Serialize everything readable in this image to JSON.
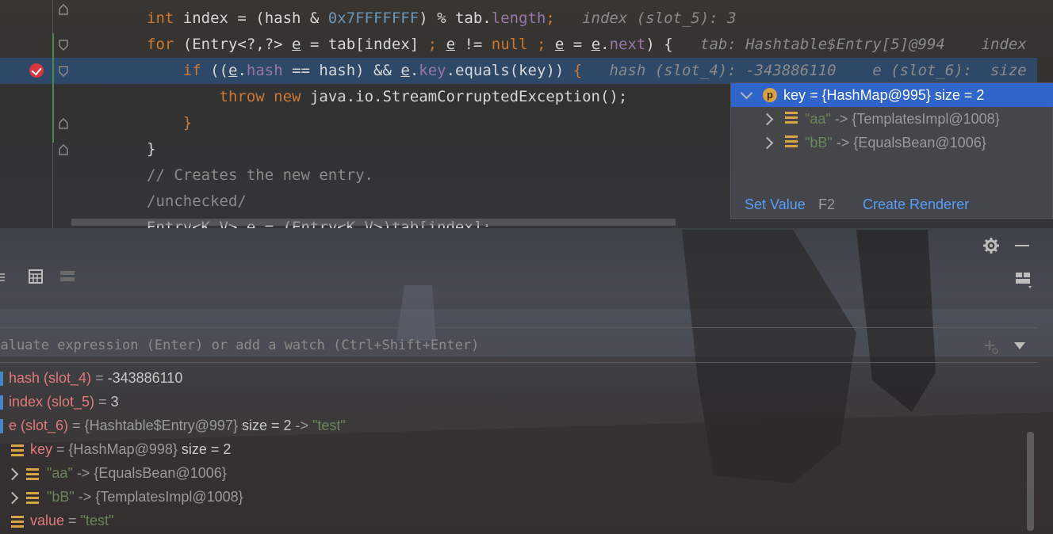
{
  "editor": {
    "lines": [
      {
        "parts": [
          {
            "t": "int",
            "c": "kw"
          },
          {
            "t": " index = (hash & "
          },
          {
            "t": "0x7FFFFFFF",
            "c": "num"
          },
          {
            "t": ") % tab."
          },
          {
            "t": "length",
            "c": "fld"
          },
          {
            "t": ";",
            "c": "kw"
          },
          {
            "t": "   index (slot_5): 3",
            "c": "inl"
          }
        ]
      },
      {
        "parts": [
          {
            "t": "for",
            "c": "kw"
          },
          {
            "t": " (Entry<?,?> "
          },
          {
            "t": "e",
            "c": "uline"
          },
          {
            "t": " = tab[index] "
          },
          {
            "t": ";",
            "c": "kw"
          },
          {
            "t": " "
          },
          {
            "t": "e",
            "c": "uline"
          },
          {
            "t": " != "
          },
          {
            "t": "null",
            "c": "kw"
          },
          {
            "t": " "
          },
          {
            "t": ";",
            "c": "kw"
          },
          {
            "t": " "
          },
          {
            "t": "e",
            "c": "uline"
          },
          {
            "t": " = "
          },
          {
            "t": "e",
            "c": "uline"
          },
          {
            "t": "."
          },
          {
            "t": "next",
            "c": "fld"
          },
          {
            "t": ") {"
          },
          {
            "t": "   tab: Hashtable$Entry[5]@994    index",
            "c": "inl"
          }
        ]
      },
      {
        "parts": [
          {
            "t": "    "
          },
          {
            "t": "if",
            "c": "kw"
          },
          {
            "t": " (("
          },
          {
            "t": "e",
            "c": "uline"
          },
          {
            "t": "."
          },
          {
            "t": "hash",
            "c": "fld"
          },
          {
            "t": " == hash) && "
          },
          {
            "t": "e",
            "c": "uline"
          },
          {
            "t": "."
          },
          {
            "t": "key",
            "c": "fld"
          },
          {
            "t": ".equals(key)) "
          },
          {
            "t": "{",
            "c": "kw"
          },
          {
            "t": "   hash (slot_4): -343886110    e (slot_6):  size",
            "c": "inl"
          }
        ]
      },
      {
        "parts": [
          {
            "t": "        "
          },
          {
            "t": "throw",
            "c": "kw"
          },
          {
            "t": " "
          },
          {
            "t": "new",
            "c": "kw"
          },
          {
            "t": " java.io.StreamCorruptedException();"
          }
        ]
      },
      {
        "parts": [
          {
            "t": "    "
          },
          {
            "t": "}",
            "c": "kw"
          }
        ]
      },
      {
        "parts": [
          {
            "t": "}"
          }
        ]
      },
      {
        "parts": [
          {
            "t": "// Creates the new entry.",
            "c": "cmt"
          }
        ]
      },
      {
        "parts": [
          {
            "t": "/unchecked/",
            "c": "cmt"
          }
        ]
      },
      {
        "parts": [
          {
            "t": "Entry<K,V> e = (Entry<K,V>)tab[index];"
          }
        ]
      }
    ]
  },
  "popup": {
    "rows": [
      {
        "icon": "p",
        "name": "key",
        "eq": " = ",
        "val": "{HashMap@995}",
        "extra": "  size = 2",
        "selected": true
      },
      {
        "icon": "field",
        "name": "\"aa\"",
        "eq": " -> ",
        "val": "{TemplatesImpl@1008}",
        "extra": "",
        "selected": false
      },
      {
        "icon": "field",
        "name": "\"bB\"",
        "eq": " -> ",
        "val": "{EqualsBean@1006}",
        "extra": "",
        "selected": false
      }
    ],
    "set_value_label": "Set Value",
    "set_value_shortcut": "F2",
    "create_renderer_label": "Create Renderer"
  },
  "eval": {
    "placeholder": "Evaluate expression (Enter) or add a watch (Ctrl+Shift+Enter)"
  },
  "variables": [
    {
      "name": "hash (slot_4)",
      "value": "-343886110",
      "type": "local"
    },
    {
      "name": "index (slot_5)",
      "value": "3",
      "type": "local"
    },
    {
      "name": "e (slot_6)",
      "value": "{Hashtable$Entry@997}",
      "extra": "size = 2 -> \"test\"",
      "type": "local"
    },
    {
      "name": "key",
      "value": "{HashMap@998}",
      "extra": "size = 2",
      "type": "field"
    },
    {
      "name": "\"aa\"",
      "value": "{EqualsBean@1006}",
      "type": "entry"
    },
    {
      "name": "\"bB\"",
      "value": "{TemplatesImpl@1008}",
      "type": "entry"
    },
    {
      "name": "value",
      "value": "\"test\"",
      "type": "field"
    }
  ],
  "colors": {
    "selection": "#2f65ca",
    "link": "#589df6",
    "keyword": "#cc7832",
    "string": "#6a8759",
    "breakpoint": "#d9363e"
  }
}
